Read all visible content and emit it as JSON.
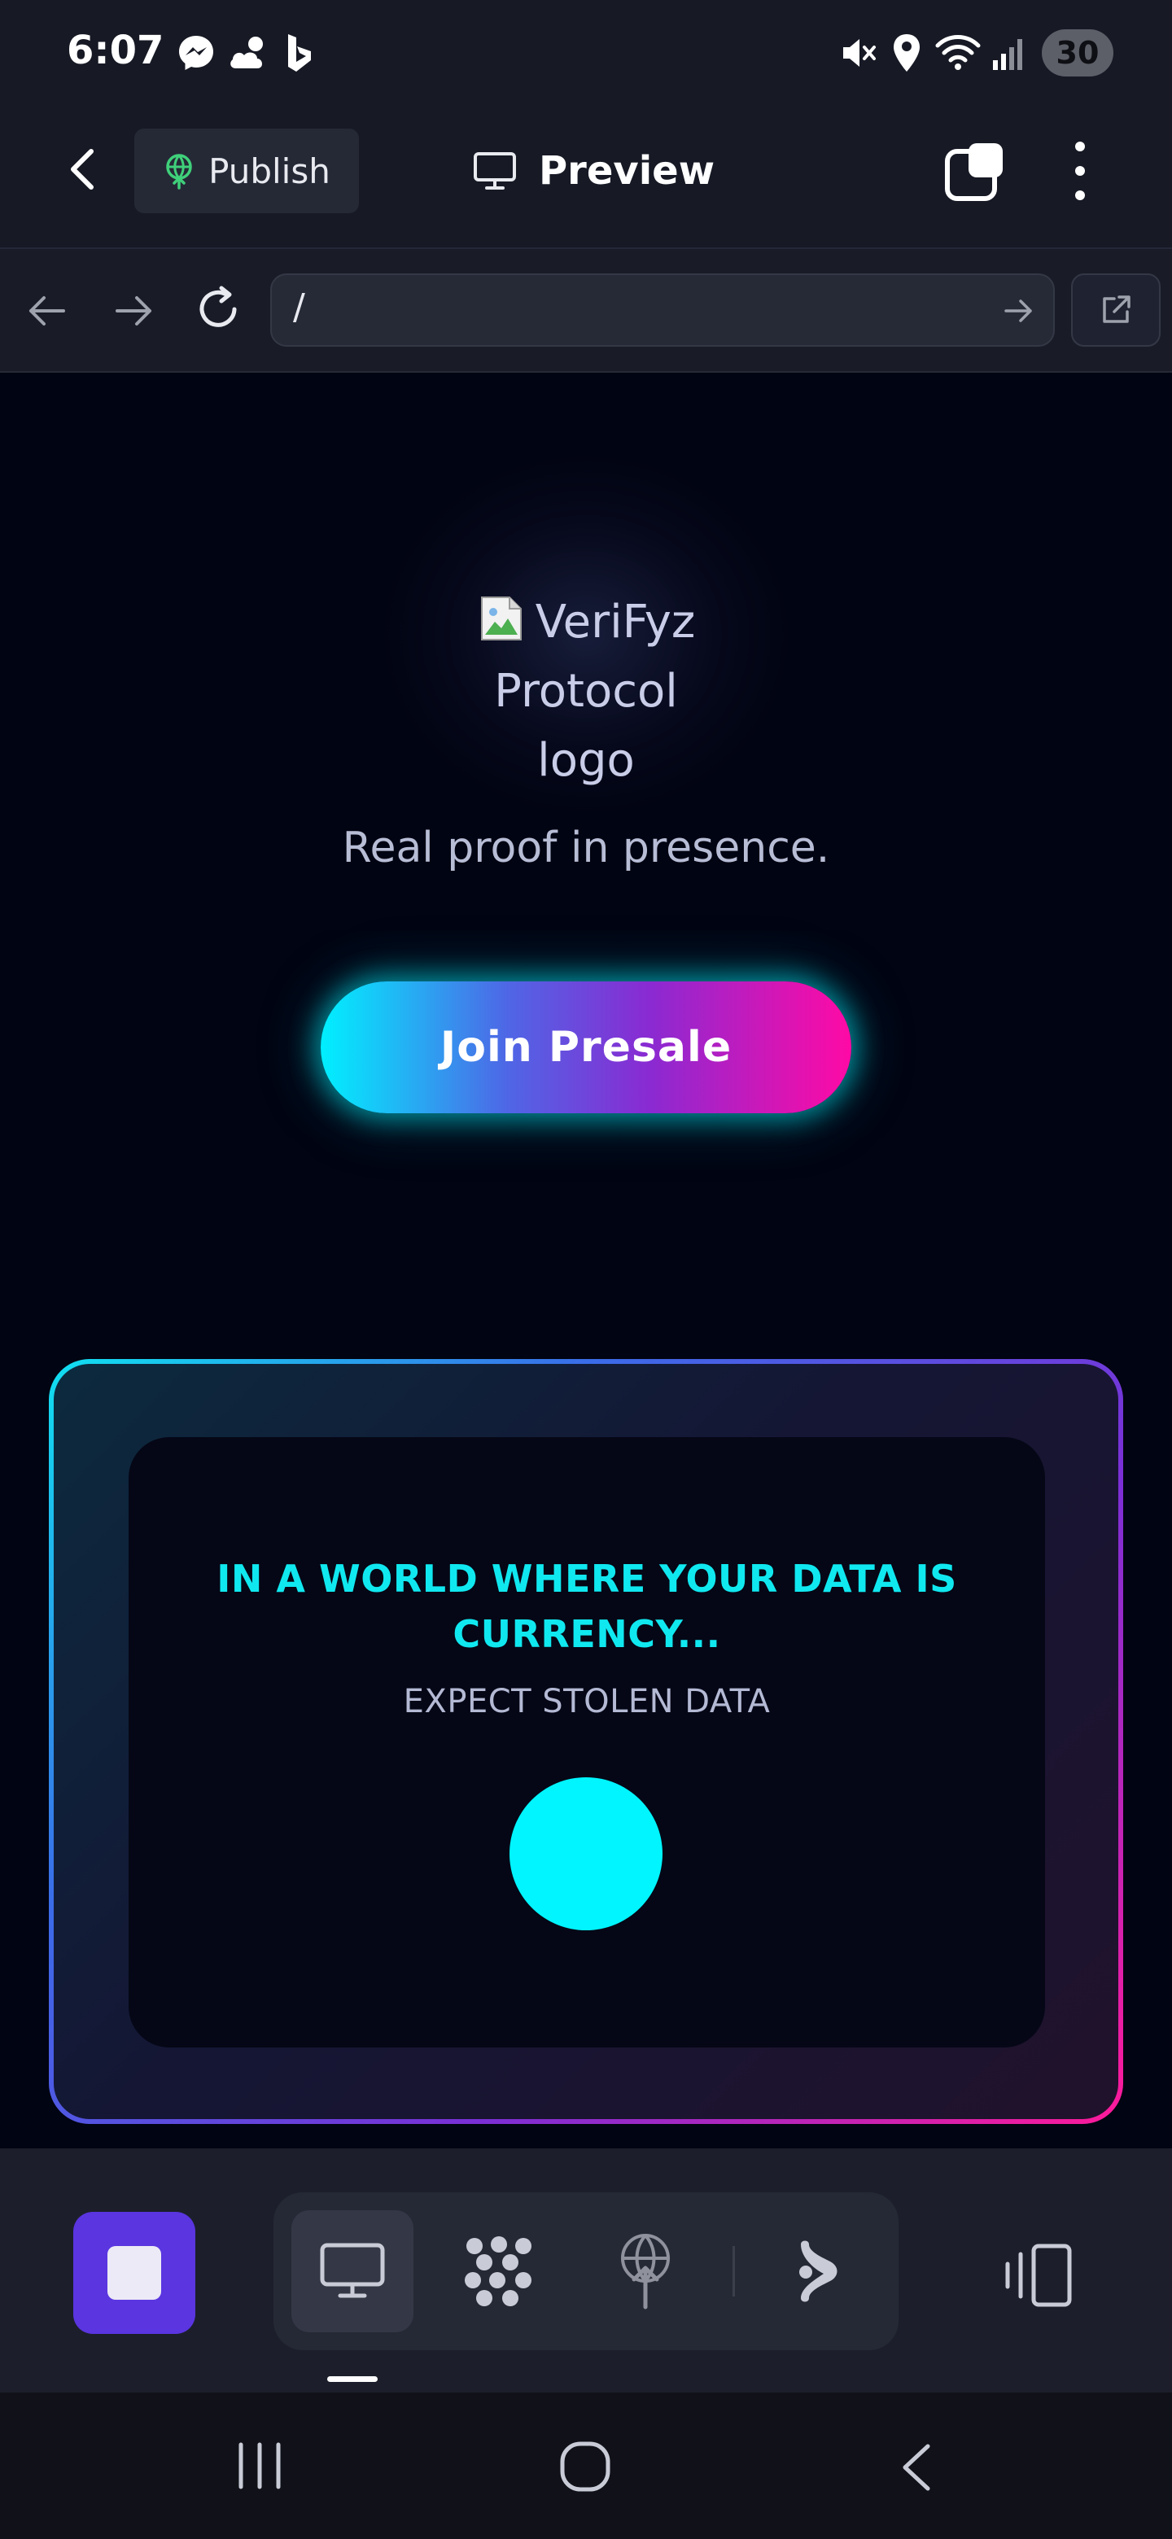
{
  "status_bar": {
    "time": "6:07",
    "icons_left": [
      "messenger-icon",
      "cloud-sun-icon",
      "bing-icon"
    ],
    "icons_right": [
      "mute-icon",
      "location-icon",
      "wifi-icon",
      "signal-icon"
    ],
    "battery": "30"
  },
  "toolbar": {
    "back_icon": "chevron-left-icon",
    "publish_label": "Publish",
    "preview_label": "Preview",
    "tabs_icon": "tabs-icon",
    "more_icon": "more-vertical-icon"
  },
  "browser": {
    "url": "/",
    "back_icon": "arrow-left-icon",
    "forward_icon": "arrow-right-icon",
    "reload_icon": "reload-icon",
    "go_icon": "arrow-right-icon",
    "open_external_icon": "external-link-icon"
  },
  "page": {
    "logo_alt_line1": "VeriFyz",
    "logo_alt_line2": "Protocol",
    "logo_alt_line3": "logo",
    "tagline": "Real proof in presence.",
    "cta_label": "Join Presale",
    "card_heading_line1": "IN A WORLD WHERE YOUR DATA IS",
    "card_heading_line2": "CURRENCY...",
    "card_subheading": "EXPECT STOLEN DATA"
  },
  "bottom_bar": {
    "stop_icon": "stop-icon",
    "tools": [
      "desktop-icon",
      "dots-grid-icon",
      "deploy-icon",
      "agent-icon"
    ],
    "device_icon": "device-toggle-icon"
  },
  "system_nav": {
    "recents_icon": "recents-icon",
    "home_icon": "home-icon",
    "back_icon": "back-icon"
  },
  "colors": {
    "background": "#010412",
    "accent_cyan": "#00f5ff",
    "accent_magenta": "#ff0aa5",
    "stop_button": "#5a35e0"
  }
}
